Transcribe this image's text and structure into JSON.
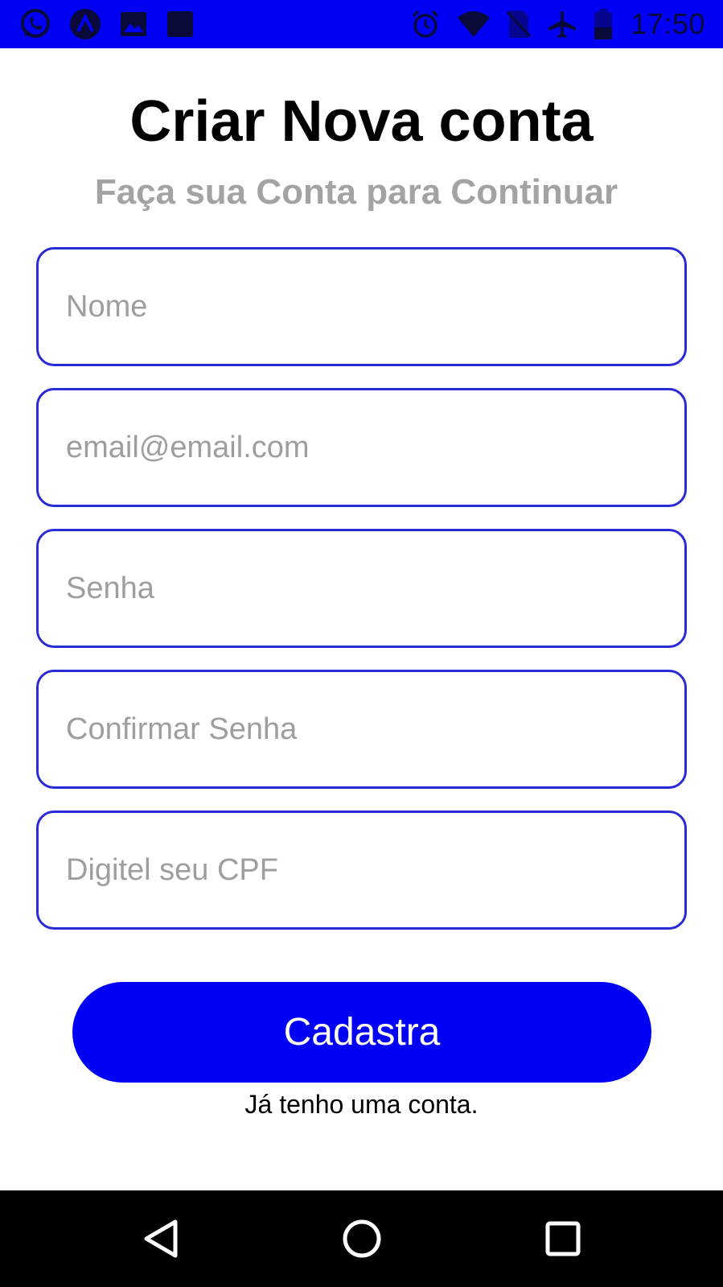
{
  "status_bar": {
    "left_icons": [
      "whatsapp-icon",
      "app-a-icon",
      "image-icon",
      "square-app-icon"
    ],
    "right_icons": [
      "alarm-icon",
      "wifi-icon",
      "no-sim-icon",
      "airplane-icon",
      "battery-icon"
    ],
    "time": "17:50"
  },
  "header": {
    "title": "Criar Nova conta",
    "subtitle": "Faça sua Conta para Continuar"
  },
  "form": {
    "name_placeholder": "Nome",
    "email_placeholder": "email@email.com",
    "password_placeholder": "Senha",
    "confirm_password_placeholder": "Confirmar Senha",
    "cpf_placeholder": "Digitel seu CPF",
    "name_value": "",
    "email_value": "",
    "password_value": "",
    "confirm_password_value": "",
    "cpf_value": ""
  },
  "actions": {
    "submit_label": "Cadastra",
    "login_link": "Já tenho uma conta."
  },
  "nav_bar": {
    "buttons": [
      "back-icon",
      "home-icon",
      "recents-icon"
    ]
  },
  "colors": {
    "accent": "#0000f5",
    "field_border": "#2a2ad6",
    "subtitle": "#a3a3a3",
    "placeholder": "#9e9e9e"
  }
}
